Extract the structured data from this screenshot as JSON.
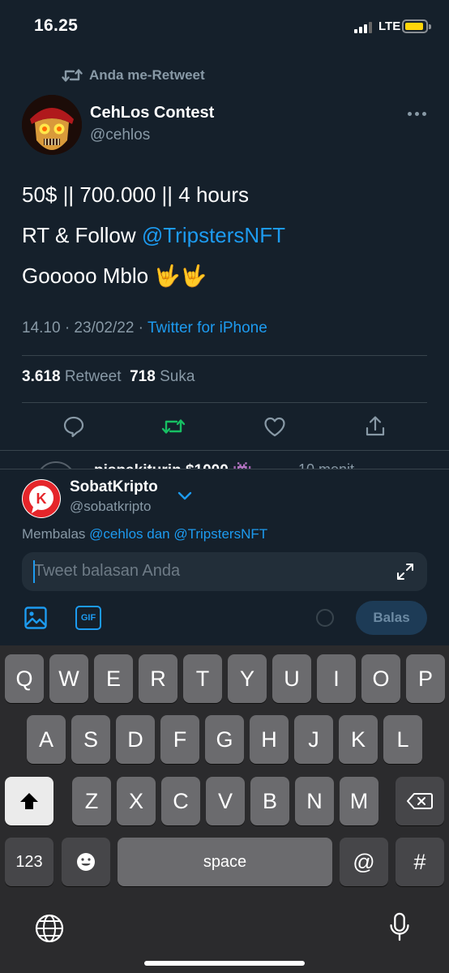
{
  "status_bar": {
    "time": "16.25",
    "network": "LTE",
    "battery_color": "#ffd60a"
  },
  "tweet": {
    "retweet_indicator": "Anda me-Retweet",
    "author_name": "CehLos Contest",
    "author_handle": "@cehlos",
    "line1": "50$ || 700.000 || 4 hours",
    "line2_prefix": "RT & Follow ",
    "line2_mention": "@TripstersNFT",
    "line3_text": "Gooooo Mblo ",
    "line3_emoji": "🤟🤟",
    "meta_time": "14.10 · 23/02/22 · ",
    "meta_source": "Twitter for iPhone",
    "retweet_count": "3.618",
    "retweet_label": "Retweet",
    "like_count": "718",
    "like_label": "Suka",
    "actions": [
      "reply-icon",
      "retweet-icon",
      "like-icon",
      "share-icon"
    ],
    "retweet_active_color": "#17bf63"
  },
  "peek_reply": {
    "text": "pispakiturin $1000 👾",
    "time": "10 menit"
  },
  "composer": {
    "user_name": "SobatKripto",
    "user_handle": "@sobatkripto",
    "replying_prefix": "Membalas ",
    "replying_mentions": "@cehlos dan @TripstersNFT",
    "placeholder": "Tweet balasan Anda",
    "gif_label": "GIF",
    "reply_button": "Balas"
  },
  "keyboard": {
    "row1": [
      "Q",
      "W",
      "E",
      "R",
      "T",
      "Y",
      "U",
      "I",
      "O",
      "P"
    ],
    "row2": [
      "A",
      "S",
      "D",
      "F",
      "G",
      "H",
      "J",
      "K",
      "L"
    ],
    "row3": [
      "Z",
      "X",
      "C",
      "V",
      "B",
      "N",
      "M"
    ],
    "num_key": "123",
    "space_key": "space",
    "at_key": "@",
    "hash_key": "#"
  },
  "colors": {
    "background": "#15202b",
    "accent": "#1d9bf0",
    "secondary_text": "#8899a6"
  }
}
